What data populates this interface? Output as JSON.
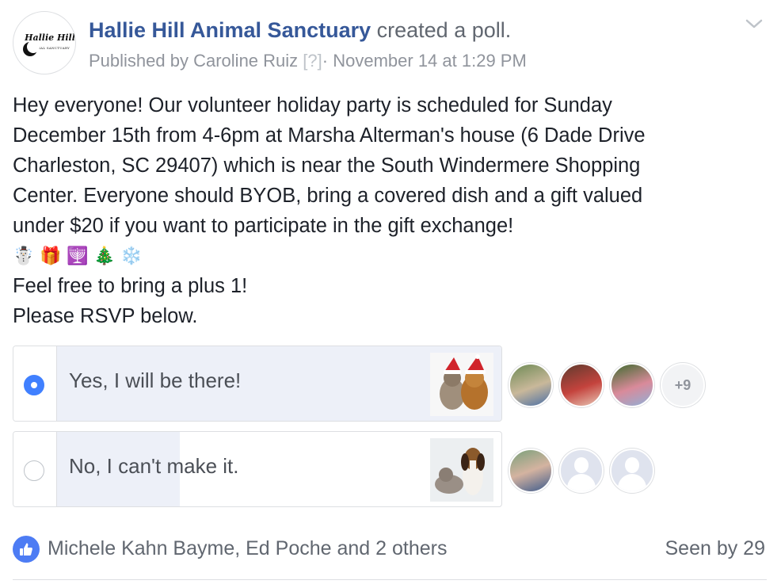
{
  "post": {
    "page_name": "Hallie Hill Animal Sanctuary",
    "action": "created a poll.",
    "publisher_prefix": "Published by",
    "publisher_name": "Caroline Ruiz",
    "help_marker": "[?]",
    "separator": "·",
    "timestamp": "November 14 at 1:29 PM",
    "logo_text": "Hallie Hill",
    "logo_subtext": "ANIMAL SANCTUARY",
    "body_lines": [
      "Hey everyone! Our volunteer holiday party is scheduled for Sunday",
      "December 15th from 4-6pm at Marsha Alterman's house (6 Dade Drive",
      "Charleston, SC 29407) which is near the South Windermere Shopping",
      "Center. Everyone should BYOB, bring a covered dish and a gift valued",
      "under $20 if you want to participate in the gift exchange!"
    ],
    "emojis": [
      "☃️",
      "🎁",
      "🕎",
      "🎄",
      "❄️"
    ],
    "closing_lines": [
      "Feel free to bring a plus 1!",
      "Please RSVP below."
    ]
  },
  "poll": {
    "options": [
      {
        "label": "Yes, I will be there!",
        "selected": true,
        "vote_share": 1.0,
        "image": "cat-and-dog-in-santa-hats",
        "voters": [
          "voter-photo",
          "voter-photo",
          "voter-photo"
        ],
        "more_label": "+9"
      },
      {
        "label": "No, I can't make it.",
        "selected": false,
        "vote_share": 0.25,
        "image": "cat-and-beagle",
        "voters": [
          "voter-photo",
          "blank-profile",
          "blank-profile"
        ],
        "more_label": ""
      }
    ]
  },
  "footer": {
    "like_icon": "thumbs-up-icon",
    "likers": "Michele Kahn Bayme, Ed Poche and 2 others",
    "seen": "Seen by 29"
  },
  "colors": {
    "link": "#365899",
    "meta": "#90949c",
    "accent": "#4080ff",
    "poll_fill": "#edf0f8",
    "like": "#4d7cf4"
  }
}
